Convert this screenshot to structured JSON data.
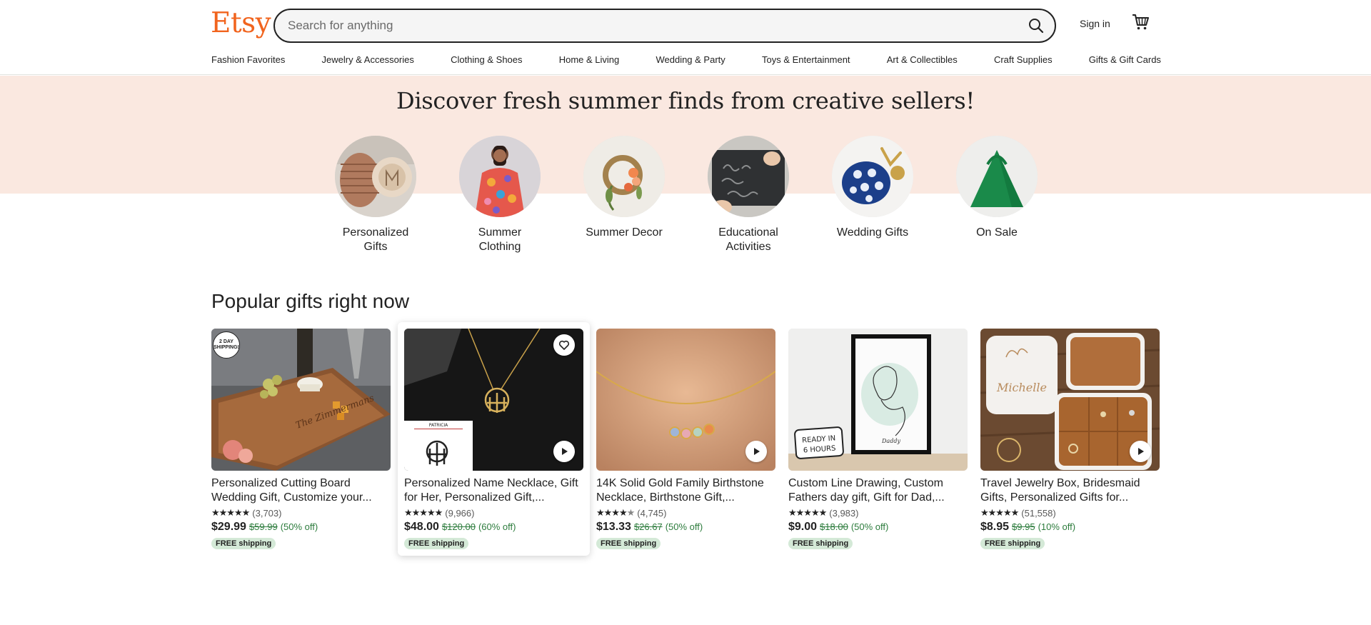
{
  "header": {
    "logo": "Etsy",
    "search_placeholder": "Search for anything",
    "signin": "Sign in"
  },
  "categories": [
    "Fashion Favorites",
    "Jewelry & Accessories",
    "Clothing & Shoes",
    "Home & Living",
    "Wedding & Party",
    "Toys & Entertainment",
    "Art & Collectibles",
    "Craft Supplies",
    "Gifts & Gift Cards"
  ],
  "hero": {
    "title": "Discover fresh summer finds from creative sellers!",
    "circles": [
      {
        "label": "Personalized Gifts"
      },
      {
        "label": "Summer Clothing"
      },
      {
        "label": "Summer Decor"
      },
      {
        "label": "Educational Activities"
      },
      {
        "label": "Wedding Gifts"
      },
      {
        "label": "On Sale"
      }
    ]
  },
  "popular": {
    "title": "Popular gifts right now",
    "products": [
      {
        "title": "Personalized Cutting Board Wedding Gift, Customize your...",
        "reviews": "(3,703)",
        "rating": 5,
        "price": "$29.99",
        "old_price": "$59.99",
        "discount": "(50% off)",
        "badge": "FREE shipping",
        "ship_badge": "2 DAY SHIPPING!",
        "video": false,
        "favorite": false
      },
      {
        "title": "Personalized Name Necklace, Gift for Her, Personalized Gift,...",
        "reviews": "(9,966)",
        "rating": 5,
        "price": "$48.00",
        "old_price": "$120.00",
        "discount": "(60% off)",
        "badge": "FREE shipping",
        "video": true,
        "favorite": true,
        "inset_name": "PATRICIA"
      },
      {
        "title": "14K Solid Gold Family Birthstone Necklace, Birthstone Gift,...",
        "reviews": "(4,745)",
        "rating": 4.5,
        "price": "$13.33",
        "old_price": "$26.67",
        "discount": "(50% off)",
        "badge": "FREE shipping",
        "video": true,
        "favorite": false
      },
      {
        "title": "Custom Line Drawing, Custom Fathers day gift, Gift for Dad,...",
        "reviews": "(3,983)",
        "rating": 5,
        "price": "$9.00",
        "old_price": "$18.00",
        "discount": "(50% off)",
        "badge": "FREE shipping",
        "video": false,
        "favorite": false,
        "sticker": "READY IN 6 HOURS"
      },
      {
        "title": "Travel Jewelry Box, Bridesmaid Gifts, Personalized Gifts for...",
        "reviews": "(51,558)",
        "rating": 5,
        "price": "$8.95",
        "old_price": "$9.95",
        "discount": "(10% off)",
        "badge": "FREE shipping",
        "video": true,
        "favorite": false
      }
    ]
  },
  "colors": {
    "brand": "#f1641e",
    "hero_band": "#fae8e0",
    "discount": "#2d7c3d",
    "free_ship_bg": "#d4e9d7"
  }
}
